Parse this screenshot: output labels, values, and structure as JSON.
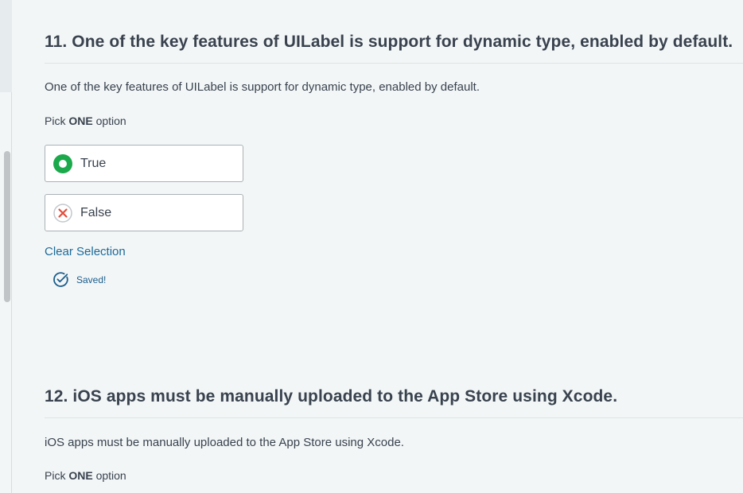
{
  "questions": [
    {
      "title": "11. One of the key features of UILabel is support for dynamic type, enabled by default.",
      "text": "One of the key features of UILabel is support for dynamic type, enabled by default.",
      "pick_prefix": "Pick ",
      "pick_strong": "ONE",
      "pick_suffix": " option",
      "options": [
        {
          "label": "True",
          "state": "selected"
        },
        {
          "label": "False",
          "state": "incorrect"
        }
      ],
      "clear_label": "Clear Selection",
      "saved_label": "Saved!"
    },
    {
      "title": "12. iOS apps must be manually uploaded to the App Store using Xcode.",
      "text": "iOS apps must be manually uploaded to the App Store using Xcode.",
      "pick_prefix": "Pick ",
      "pick_strong": "ONE",
      "pick_suffix": " option"
    }
  ],
  "colors": {
    "background": "#f2f6f7",
    "selected_green": "#1ba94c",
    "incorrect_red": "#e04f3c",
    "link_blue": "#1c6a99"
  },
  "icons": {
    "selected": "radio-selected-icon",
    "incorrect": "x-circle-icon",
    "saved": "check-circle-icon"
  }
}
